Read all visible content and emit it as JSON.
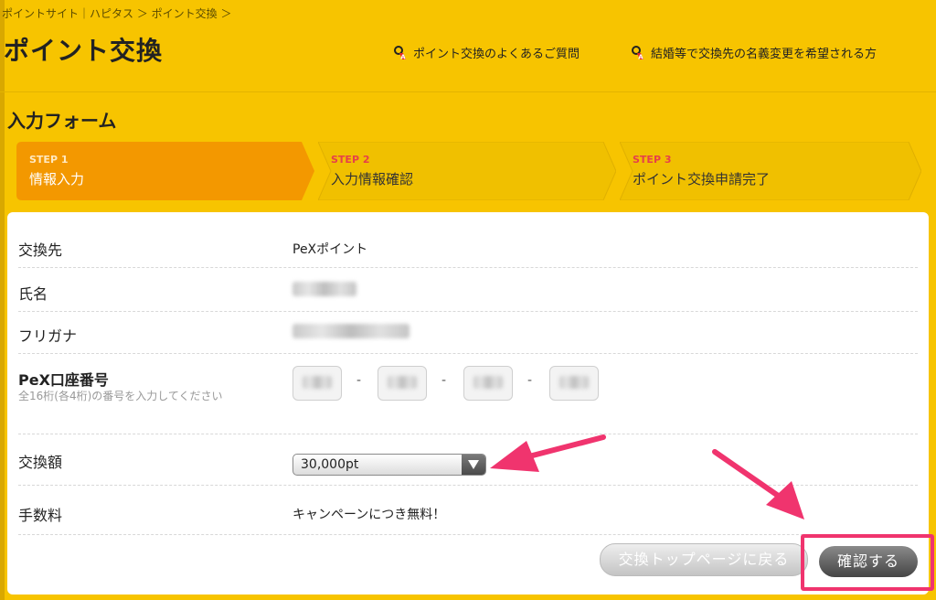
{
  "breadcrumb": "ポイントサイト｜ハピタス ＞ ポイント交換 ＞",
  "page_title": "ポイント交換",
  "help_links": [
    {
      "label": "ポイント交換のよくあるご質問",
      "icon": "key-icon"
    },
    {
      "label": "結婚等で交換先の名義変更を希望される方",
      "icon": "key-icon"
    }
  ],
  "section_title": "入力フォーム",
  "steps": [
    {
      "num": "STEP 1",
      "name": "情報入力",
      "active": true
    },
    {
      "num": "STEP 2",
      "name": "入力情報確認",
      "active": false
    },
    {
      "num": "STEP 3",
      "name": "ポイント交換申請完了",
      "active": false
    }
  ],
  "form": {
    "exchange_to_label": "交換先",
    "exchange_to_value": "PeXポイント",
    "name_label": "氏名",
    "furigana_label": "フリガナ",
    "pex_label": "PeX口座番号",
    "pex_sub": "全16桁(各4桁)の番号を入力してください",
    "pex_sep": "-",
    "amount_label": "交換額",
    "amount_value": "30,000pt",
    "fee_label": "手数料",
    "fee_value": "キャンペーンにつき無料！"
  },
  "buttons": {
    "back": "交換トップページに戻る",
    "confirm": "確認する"
  },
  "colors": {
    "background": "#f7c400",
    "step_active": "#f39800",
    "step_inactive": "#f0c000",
    "step_num_inactive": "#e6404a",
    "annotation": "#f0346e"
  }
}
